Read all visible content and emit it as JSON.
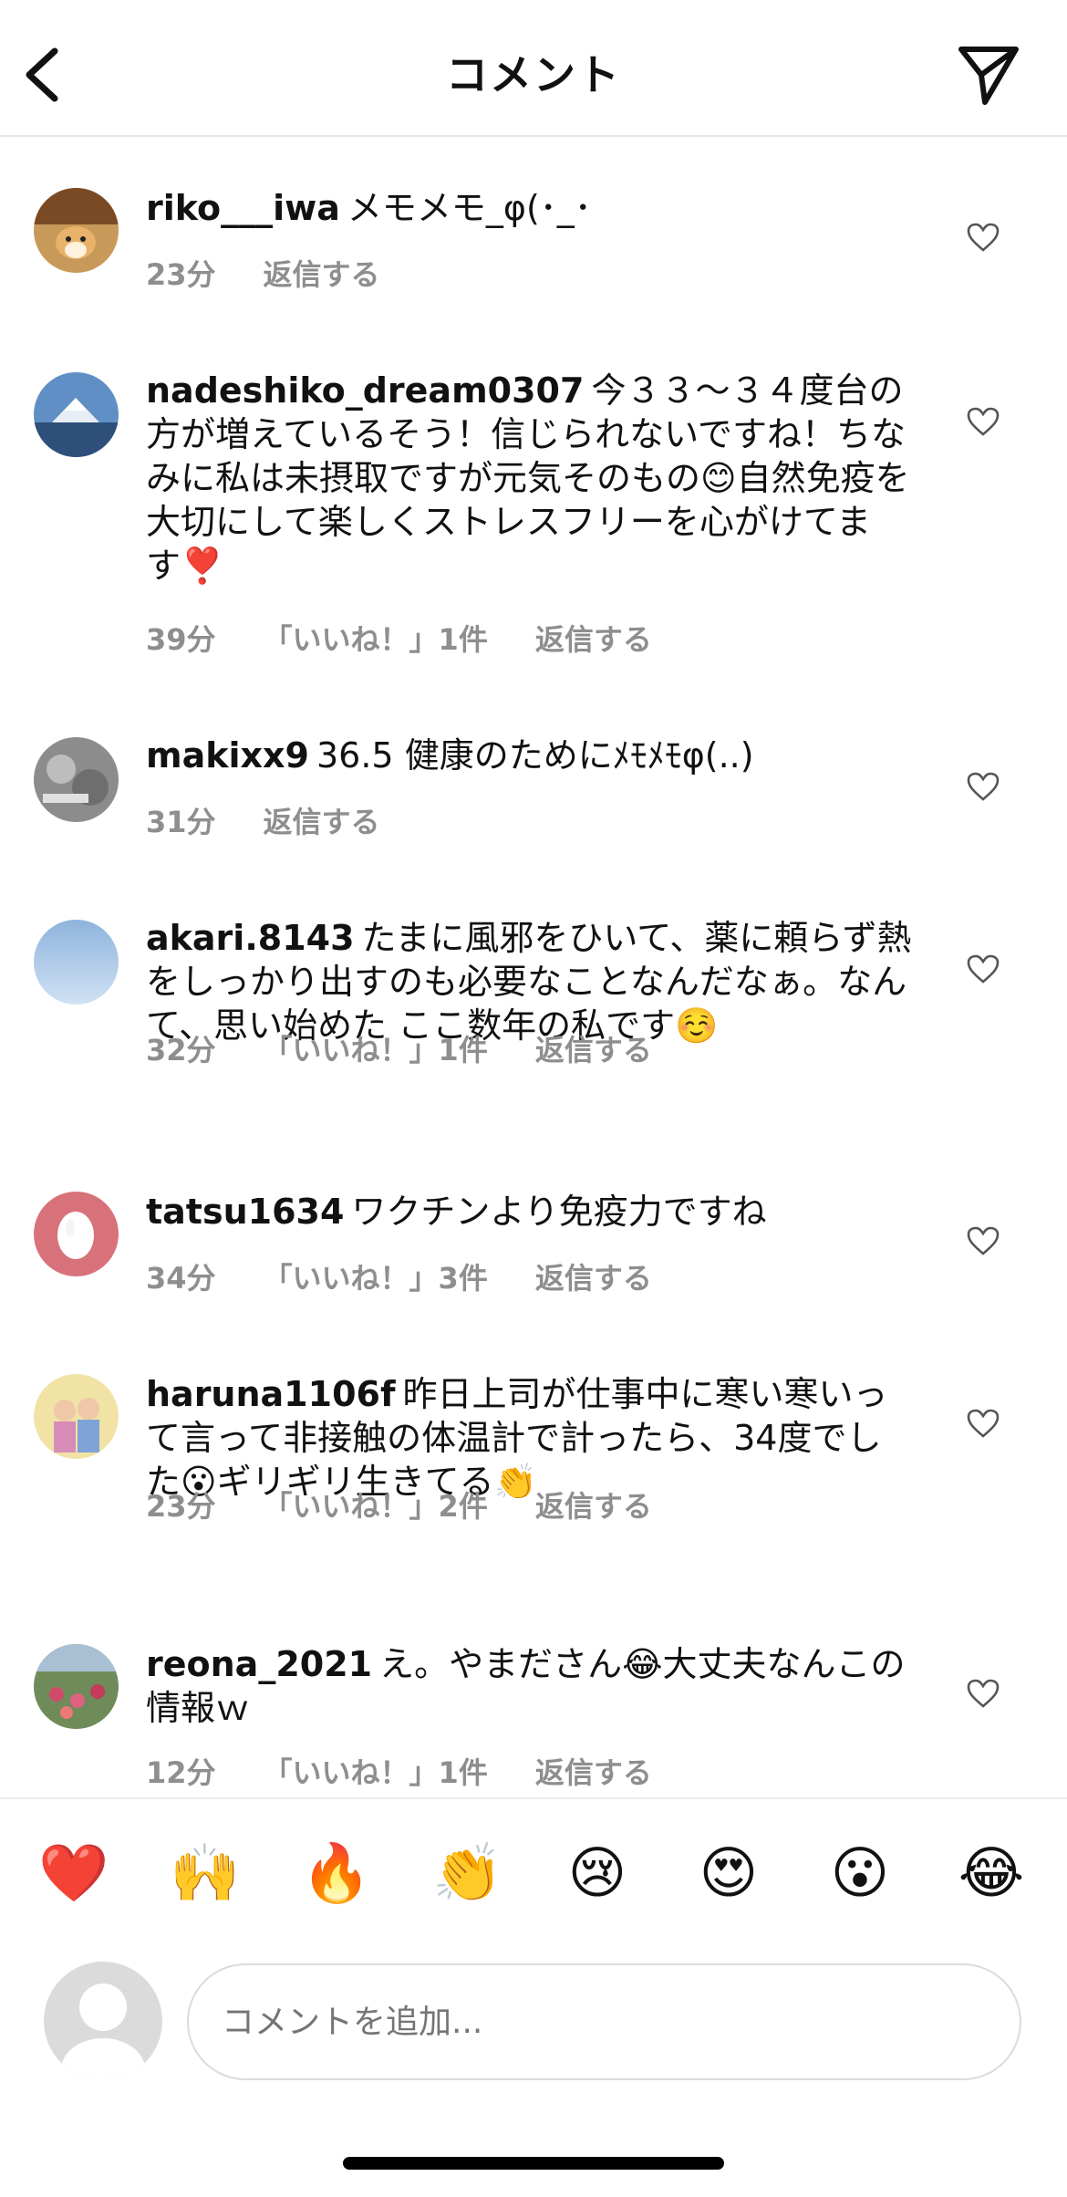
{
  "header": {
    "title": "コメント",
    "back_icon": "chevron-left-icon",
    "share_icon": "paper-plane-icon"
  },
  "comments": [
    {
      "username": "riko___iwa",
      "text": "メモメモ_φ(･_･",
      "time": "23分",
      "likes": "",
      "reply": "返信する"
    },
    {
      "username": "nadeshiko_dream0307",
      "text": "今３３〜３４度台の方が増えているそう！信じられないですね！ちなみに私は未摂取ですが元気そのもの😊自然免疫を大切にして楽しくストレスフリーを心がけてます❣️",
      "time": "39分",
      "likes": "「いいね！」1件",
      "reply": "返信する"
    },
    {
      "username": "makixx9",
      "text": "36.5 健康のためにﾒﾓﾒﾓφ(..)",
      "time": "31分",
      "likes": "",
      "reply": "返信する"
    },
    {
      "username": "akari.8143",
      "text": "たまに風邪をひいて、薬に頼らず熱をしっかり出すのも必要なことなんだなぁ。なんて、思い始めた ここ数年の私です☺️",
      "time": "32分",
      "likes": "「いいね！」1件",
      "reply": "返信する"
    },
    {
      "username": "tatsu1634",
      "text": "ワクチンより免疫力ですね",
      "time": "34分",
      "likes": "「いいね！」3件",
      "reply": "返信する"
    },
    {
      "username": "haruna1106f",
      "text": "昨日上司が仕事中に寒い寒いって言って非接触の体温計で計ったら、34度でした😮ギリギリ生きてる👏",
      "time": "23分",
      "likes": "「いいね！」2件",
      "reply": "返信する"
    },
    {
      "username": "reona_2021",
      "text": "え。やまださん😂大丈夫なんこの情報ｗ",
      "time": "12分",
      "likes": "「いいね！」1件",
      "reply": "返信する"
    }
  ],
  "emoji_bar": [
    "❤️",
    "🙌",
    "🔥",
    "👏",
    "😢",
    "😍",
    "😮",
    "😂"
  ],
  "input": {
    "placeholder": "コメントを追加..."
  }
}
